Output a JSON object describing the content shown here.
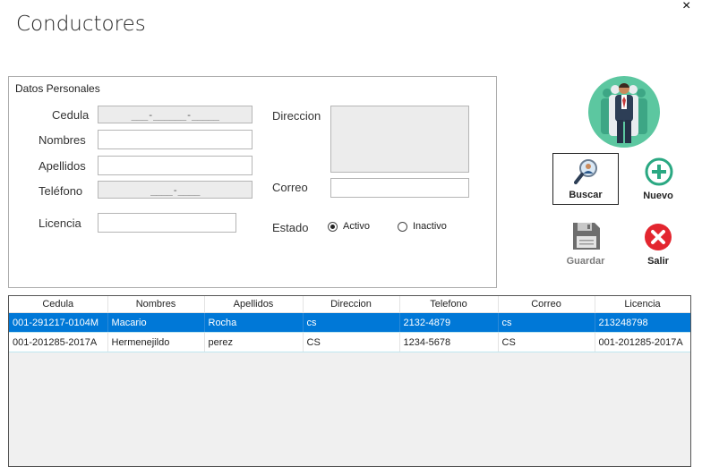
{
  "window": {
    "title": "Conductores",
    "close_glyph": "×"
  },
  "group": {
    "legend": "Datos Personales",
    "labels": {
      "cedula": "Cedula",
      "nombres": "Nombres",
      "apellidos": "Apellidos",
      "telefono": "Teléfono",
      "licencia": "Licencia",
      "direccion": "Direccion",
      "correo": "Correo",
      "estado": "Estado"
    },
    "fields": {
      "cedula_mask": "___-______-_____",
      "telefono_mask": "____-____",
      "nombres": "",
      "apellidos": "",
      "licencia": "",
      "direccion": "",
      "correo": ""
    },
    "estado": {
      "activo": "Activo",
      "inactivo": "Inactivo",
      "selected": "Activo"
    }
  },
  "toolbar": {
    "logo_icon": "drivers-group-icon",
    "buscar": "Buscar",
    "nuevo": "Nuevo",
    "guardar": "Guardar",
    "salir": "Salir",
    "colors": {
      "nuevo": "#2aa882",
      "salir": "#e3262f",
      "guardar_disabled": "#7a7a7a"
    }
  },
  "grid": {
    "columns": [
      "Cedula",
      "Nombres",
      "Apellidos",
      "Direccion",
      "Telefono",
      "Correo",
      "Licencia"
    ],
    "rows": [
      [
        "001-291217-0104M",
        "Macario",
        "Rocha",
        "cs",
        "2132-4879",
        "cs",
        "213248798"
      ],
      [
        "001-201285-2017A",
        "Hermenejildo",
        "perez",
        "CS",
        "1234-5678",
        "CS",
        "001-201285-2017A"
      ]
    ],
    "selected_row": 0,
    "selection_color": "#0078d7"
  }
}
